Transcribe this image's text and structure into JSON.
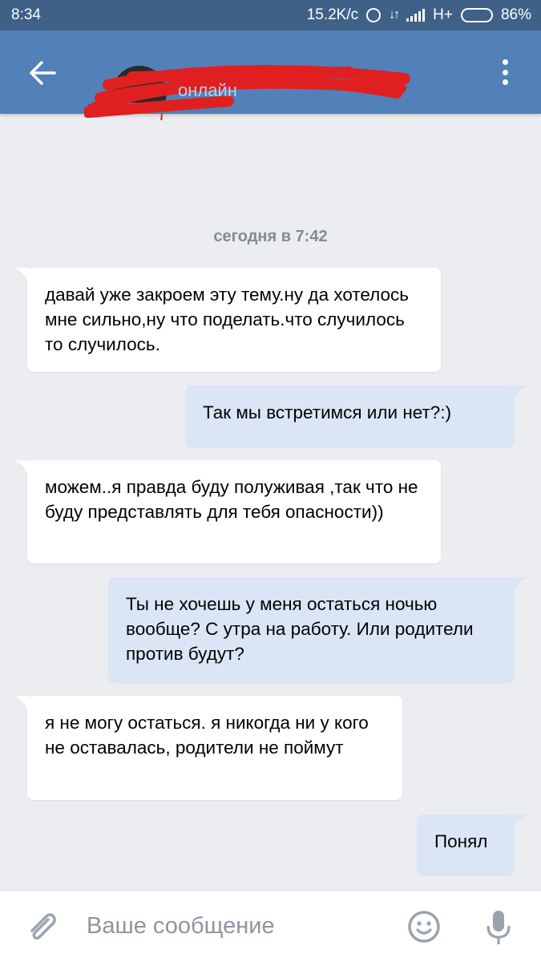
{
  "status_bar": {
    "time": "8:34",
    "speed": "15.2K/c",
    "network": "H+",
    "battery": "86%",
    "battery_level": 0.86
  },
  "header": {
    "status": "онлайн",
    "back_icon": "arrow-left-icon",
    "menu_icon": "more-vertical-icon"
  },
  "chat": {
    "date_divider": "сегодня в 7:42",
    "messages": [
      {
        "direction": "in",
        "text": "давай уже закроем эту тему.ну да хотелось мне сильно,ну что поделать.что случилось то случилось."
      },
      {
        "direction": "out",
        "text": "Так мы встретимся или нет?:)"
      },
      {
        "direction": "in",
        "text": "можем..я правда буду полуживая ,так что не буду представлять для тебя опасности))"
      },
      {
        "direction": "out",
        "text": "Ты не хочешь у меня остаться ночью вообще? С утра на работу. Или родители против будут?"
      },
      {
        "direction": "in",
        "text": "я не могу остаться. я никогда ни у кого не оставалась, родители не поймут"
      },
      {
        "direction": "out",
        "text": "Понял"
      }
    ]
  },
  "compose": {
    "placeholder": "Ваше сообщение",
    "attach_icon": "paperclip-icon",
    "emoji_icon": "smiley-icon",
    "mic_icon": "microphone-icon"
  },
  "colors": {
    "header": "#5181b8",
    "status_bar": "#3f6187",
    "background": "#ebedf0",
    "incoming_bubble": "#ffffff",
    "outgoing_bubble": "#dae6f5",
    "redaction": "#e02020"
  }
}
